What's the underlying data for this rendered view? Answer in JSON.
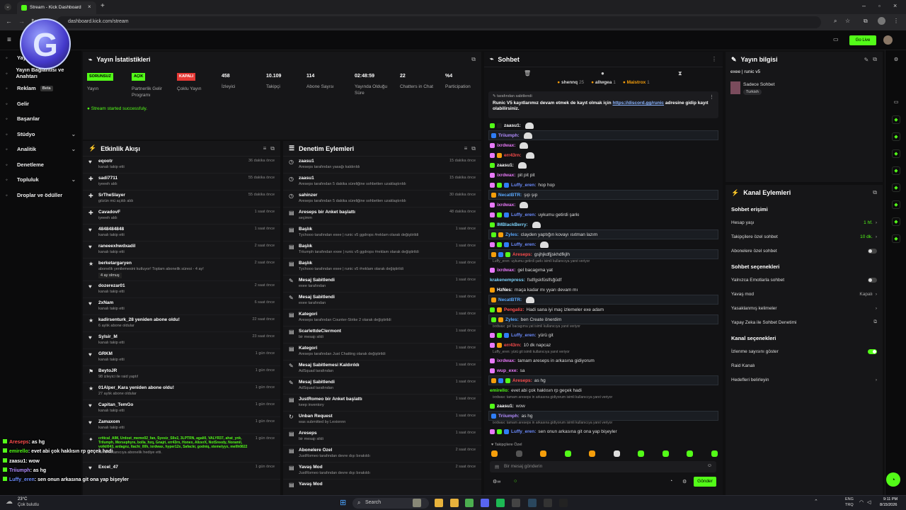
{
  "browser": {
    "tab_title": "Stream - Kick Dashboard",
    "url": "dashboard.kick.com/stream",
    "tab_close": "×",
    "new_tab": "+"
  },
  "topnav": {
    "go_live": "Go Live"
  },
  "sidebar": {
    "items": [
      {
        "label": "Yayın",
        "icon": "stream-icon"
      },
      {
        "label": "Yayın Bağlantısı ve Anahtarı",
        "icon": "link-icon"
      },
      {
        "label": "Reklam",
        "badge": "Beta",
        "icon": "ad-icon"
      },
      {
        "label": "Gelir",
        "icon": "revenue-icon"
      },
      {
        "label": "Başarılar",
        "icon": "achievements-icon"
      },
      {
        "label": "Stüdyo",
        "chevron": "⌄",
        "icon": "studio-icon"
      },
      {
        "label": "Analitik",
        "chevron": "⌄",
        "icon": "analytics-icon"
      },
      {
        "label": "Denetleme",
        "icon": "moderation-icon"
      },
      {
        "label": "Topluluk",
        "chevron": "⌄",
        "icon": "community-icon"
      },
      {
        "label": "Droplar ve ödüller",
        "icon": "drops-icon"
      }
    ]
  },
  "stats": {
    "title": "Yayın İstatistikleri",
    "items": [
      {
        "value": "SORUNSUZ",
        "label": "Yayın",
        "badge_color": "#53fc18"
      },
      {
        "value": "AÇIK",
        "label": "Partnerlik Gelir Programı",
        "badge_color": "#53fc18"
      },
      {
        "value": "KAPALI",
        "label": "Çoklu Yayın",
        "badge_color": "#e53935"
      },
      {
        "value": "458",
        "label": "İzleyici"
      },
      {
        "value": "10.109",
        "label": "Takipçi"
      },
      {
        "value": "114",
        "label": "Abone Sayısı"
      },
      {
        "value": "02:48:59",
        "label": "Yayında Olduğu Süre"
      },
      {
        "value": "22",
        "label": "Chatters in Chat"
      },
      {
        "value": "%4",
        "label": "Participation"
      }
    ],
    "status": "Stream started successfuly."
  },
  "activity": {
    "title": "Etkinlik Akışı",
    "items": [
      {
        "name": "eqootr",
        "sub": "kanalı takip etti",
        "time": "36 dakika önce",
        "icon": "♥"
      },
      {
        "name": "sadi7711",
        "sub": "iyeeeh aldı",
        "time": "55 dakika önce",
        "icon": "✚"
      },
      {
        "name": "SrTheSlayer",
        "sub": "gözün mü açıldı aldı",
        "time": "55 dakika önce",
        "icon": "✚"
      },
      {
        "name": "CavadovF",
        "sub": "iyeeeh aldı",
        "time": "1 saat önce",
        "icon": "✚"
      },
      {
        "name": "4848484848",
        "sub": "kanalı takip etti",
        "time": "1 saat önce",
        "icon": "♥"
      },
      {
        "name": "raneeexhwdxadil",
        "sub": "kanalı takip etti",
        "time": "2 saat önce",
        "icon": "♥"
      },
      {
        "name": "berketargaryen",
        "sub": "abonelik yenilemesini kutluyor! Toplam abonelik süresi - 4 ay!",
        "extra": "4 ay olmuş",
        "time": "2 saat önce",
        "icon": "★"
      },
      {
        "name": "dozerezar01",
        "sub": "kanalı takip etti",
        "time": "2 saat önce",
        "icon": "♥"
      },
      {
        "name": "2xNam",
        "sub": "kanalı takip etti",
        "time": "6 saat önce",
        "icon": "♥"
      },
      {
        "name": "kadirsenturk_28 yeniden abone oldu!",
        "sub": "6 aylık abone oldular",
        "time": "22 saat önce",
        "icon": "★"
      },
      {
        "name": "Sylsir_M",
        "sub": "kanalı takip etti",
        "time": "23 saat önce",
        "icon": "♥"
      },
      {
        "name": "GRKM",
        "sub": "kanalı takip etti",
        "time": "1 gün önce",
        "icon": "♥"
      },
      {
        "name": "BeytoJR",
        "sub": "98 izleyici ile raid yaptı!",
        "time": "1 gün önce",
        "icon": "⚑"
      },
      {
        "name": "01Alper_Kara yeniden abone oldu!",
        "sub": "27 aylık abone oldular",
        "time": "1 gün önce",
        "icon": "★"
      },
      {
        "name": "Capitan_TemGo",
        "sub": "kanalı takip etti",
        "time": "1 gün önce",
        "icon": "♥"
      },
      {
        "name": "Zamaxom",
        "sub": "kanalı takip etti",
        "time": "1 gün önce",
        "icon": "♥"
      },
      {
        "name": "critical_AIM, Urdost_memo02_fan, Syesiz_S6v2, 3LPTRN, agali0, VALYR37, ahat_ynk, Trilumph, Morsephyre, bolla_hzq, Gnajri, err43rn, Honex, AlizerX, NotSreedy, Noramil, volkil043, ardagnz, Itachi_00h, ixrdwax, hyper12x, Safackr, godniq, xtemelyyx, mellh0822",
        "sub": "isimli kullanıcıya abonelik hediye etti.",
        "time": "1 gün önce",
        "icon": "✦"
      },
      {
        "name": "Excel_47",
        "sub": "",
        "time": "1 gün önce",
        "icon": "♥"
      }
    ]
  },
  "moderation": {
    "title": "Denetim Eylemleri",
    "items": [
      {
        "name": "zaasu1",
        "sub": "Areseps tarafından yasağı kaldırıldı",
        "time": "15 dakika önce",
        "icon": "◷"
      },
      {
        "name": "zaasu1",
        "sub": "Areseps tarafından 5 dakika süreliğine sohbetten uzaklaştırıldı",
        "time": "15 dakika önce",
        "icon": "◷"
      },
      {
        "name": "sahinzer",
        "sub": "Areseps tarafından 5 dakika süreliğine sohbetten uzaklaştırıldı",
        "time": "30 dakika önce",
        "icon": "◷"
      },
      {
        "name": "Areseps bir Anket başlattı",
        "sub": "seçimm",
        "time": "48 dakika önce",
        "icon": "▤"
      },
      {
        "name": "Başlık",
        "sub": "Tychooo tarafından exee | runic v5 ggdrops #reklam olarak değiştirildi",
        "time": "1 saat önce",
        "icon": "▤"
      },
      {
        "name": "Başlık",
        "sub": "Triiumph tarafından exee | runic v5 ggdrops #reklam olarak değiştirildi",
        "time": "1 saat önce",
        "icon": "▤"
      },
      {
        "name": "Başlık",
        "sub": "Tychooo tarafından exee | runic v5 #reklam olarak değiştirildi",
        "time": "1 saat önce",
        "icon": "▤"
      },
      {
        "name": "Mesaj Sabitlendi",
        "sub": "exee tarafından",
        "time": "1 saat önce",
        "icon": "✎"
      },
      {
        "name": "Mesaj Sabitlendi",
        "sub": "exee tarafından",
        "time": "1 saat önce",
        "icon": "✎"
      },
      {
        "name": "Kategori",
        "sub": "Areseps tarafından Counter-Strike 2 olarak değiştirildi",
        "time": "1 saat önce",
        "icon": "▤"
      },
      {
        "name": "ScarlettdeClermont",
        "sub": "bir mesajı sildi",
        "time": "1 saat önce",
        "icon": "▤"
      },
      {
        "name": "Kategori",
        "sub": "Areseps tarafından Just Chatting olarak değiştirildi",
        "time": "1 saat önce",
        "icon": "▤"
      },
      {
        "name": "Mesaj Sabitlemesi Kaldırıldı",
        "sub": "AdSquad tarafından",
        "time": "1 saat önce",
        "icon": "✎"
      },
      {
        "name": "Mesaj Sabitlendi",
        "sub": "AdSquad tarafından",
        "time": "1 saat önce",
        "icon": "✎"
      },
      {
        "name": "JustRomeo bir Anket başlattı",
        "sub": "keep inventory",
        "time": "1 saat önce",
        "icon": "▤"
      },
      {
        "name": "Unban Request",
        "sub": "was submitted by Lexionnn",
        "time": "1 saat önce",
        "icon": "↻"
      },
      {
        "name": "Areseps",
        "sub": "bir mesajı sildi",
        "time": "1 saat önce",
        "icon": "▤"
      },
      {
        "name": "Abonelere Özel",
        "sub": "JustRomeo tarafından devre dışı bırakıldı",
        "time": "2 saat önce",
        "icon": "▤"
      },
      {
        "name": "Yavaş Mod",
        "sub": "JustRomeo tarafından devre dışı bırakıldı",
        "time": "2 saat önce",
        "icon": "▤"
      },
      {
        "name": "Yavaş Mod",
        "sub": "",
        "time": "",
        "icon": "▤"
      }
    ]
  },
  "chat": {
    "title": "Sohbet",
    "top_gifters": [
      {
        "name": "shennq",
        "n": "25"
      },
      {
        "name": "allwgea",
        "n": "1"
      },
      {
        "name": "Maistrox",
        "n": "1"
      }
    ],
    "pinned": {
      "by": "tarafından sabitlendi",
      "text": "Runic V5 kayıtlarımız devam etmek de kayıt olmak için",
      "link": "https://discord.gg/runic",
      "text2": "adresine gidip kayıt olabilirsiniz."
    },
    "lines": [
      {
        "u": "zaasu1:",
        "c": "#ffffff",
        "m": "",
        "b": [
          "#53fc18",
          "#1e1e1e"
        ]
      },
      {
        "u": "Triiumph:",
        "c": "#b28cff",
        "m": "",
        "b": [
          "#2f7df6"
        ],
        "hl": true
      },
      {
        "u": "ixrdwax:",
        "c": "#e879f9",
        "m": "",
        "b": [
          "#e879f9"
        ]
      },
      {
        "u": "err43rn:",
        "c": "#ff4d4d",
        "m": "",
        "b": [
          "#e879f9",
          "#f59e0b"
        ]
      },
      {
        "u": "zaasu1:",
        "c": "#ffffff",
        "m": "",
        "b": [
          "#53fc18"
        ]
      },
      {
        "u": "ixrdwax:",
        "c": "#e879f9",
        "m": "pit pit pit",
        "b": [
          "#e879f9"
        ]
      },
      {
        "u": "Luffy_eren:",
        "c": "#6c8cff",
        "m": "hop hop",
        "b": [
          "#e879f9",
          "#53fc18",
          "#2f7df6"
        ]
      },
      {
        "u": "NecatBTR:",
        "c": "#5aa9ff",
        "m": "şıp şıp",
        "b": [
          "#f59e0b"
        ],
        "hl": true
      },
      {
        "u": "ixrdwax:",
        "c": "#e879f9",
        "m": "",
        "b": [
          "#e879f9"
        ]
      },
      {
        "u": "Luffy_eren:",
        "c": "#6c8cff",
        "m": "uykumu getirdi şarkı",
        "b": [
          "#e879f9",
          "#53fc18",
          "#2f7df6"
        ]
      },
      {
        "u": "IMBlackBerry:",
        "c": "#7dd3fc",
        "m": "",
        "b": [
          "#53fc18"
        ]
      },
      {
        "u": "Zyles:",
        "c": "#5aa9ff",
        "m": "clayden yaptığın kovayı ısıtman lazım",
        "b": [
          "#53fc18",
          "#f59e0b"
        ],
        "hl": true
      },
      {
        "u": "Luffy_eren:",
        "c": "#6c8cff",
        "m": "",
        "b": [
          "#e879f9",
          "#53fc18",
          "#2f7df6"
        ]
      },
      {
        "u": "Areseps:",
        "c": "#ff4d4d",
        "m": "gsjhjkdfjjskhdfkjlh",
        "b": [
          "#f59e0b",
          "#2f7df6",
          "#53fc18"
        ],
        "hl": true
      }
    ],
    "lines2": [
      {
        "u": "ixrdwax:",
        "c": "#e879f9",
        "m": "gel bacagıma yat",
        "b": [
          "#e879f9"
        ],
        "sys": "Luffy_eren: uykumu getirdi şarkı isimli kullanıcıya yanıt veriyor"
      },
      {
        "u": "krakenempress:",
        "c": "#7dd3fc",
        "m": "fsdfgskfüslfsğüdf",
        "b": []
      },
      {
        "u": "HzNes:",
        "c": "#ffffff",
        "m": "maça kadar mı yyarı devam mı",
        "b": [
          "#f59e0b"
        ]
      },
      {
        "u": "NecatBTR:",
        "c": "#5aa9ff",
        "m": "",
        "b": [
          "#f59e0b"
        ],
        "hl": true
      },
      {
        "u": "Pengaliz:",
        "c": "#ff4d4d",
        "m": "Hadi sana iyi maç izlemeler exe adam",
        "b": [
          "#53fc18",
          "#f59e0b"
        ]
      },
      {
        "u": "Zyles:",
        "c": "#5aa9ff",
        "m": "ben Create önerdim",
        "b": [
          "#53fc18",
          "#f59e0b"
        ],
        "hl": true
      },
      {
        "u": "Luffy_eren:",
        "c": "#6c8cff",
        "m": "yürü git",
        "b": [
          "#e879f9",
          "#53fc18",
          "#2f7df6"
        ],
        "sys": "ixrdwax: gel bacagıma yat isimli kullanıcıya yanıt veriyor"
      },
      {
        "u": "err43rn:",
        "c": "#ff4d4d",
        "m": "10 dk napcaz",
        "b": [
          "#e879f9",
          "#f59e0b"
        ]
      },
      {
        "u": "ixrdwax:",
        "c": "#e879f9",
        "m": "tamam areseps in arkasına gidiyorum",
        "b": [
          "#e879f9"
        ],
        "sys": "Luffy_eren: yürü git isimli kullanıcıya yanıt veriyor"
      },
      {
        "u": "wup_exe:",
        "c": "#e879f9",
        "m": "sa",
        "b": [
          "#e879f9"
        ]
      },
      {
        "u": "Areseps:",
        "c": "#ff4d4d",
        "m": "as hg",
        "b": [
          "#f59e0b",
          "#2f7df6",
          "#53fc18"
        ],
        "hl": true
      },
      {
        "u": "emirello:",
        "c": "#53fc18",
        "m": "evet abi çok haklısın rp geçek hadi",
        "b": []
      },
      {
        "u": "zaasu1:",
        "c": "#ffffff",
        "m": "wow",
        "b": [
          "#53fc18"
        ],
        "sys": "ixrdwax: tamam areseps in arkasına gidiyorum isimli kullanıcıya yanıt veriyor"
      },
      {
        "u": "Triiumph:",
        "c": "#b28cff",
        "m": "as hg",
        "b": [
          "#2f7df6"
        ],
        "hl": true
      },
      {
        "u": "Luffy_eren:",
        "c": "#6c8cff",
        "m": "sen onun arkasına git ona yap bişeyler",
        "b": [
          "#e879f9",
          "#53fc18",
          "#2f7df6"
        ],
        "sys": "ixrdwax: tamam areseps in arkasına gidiyorum isimli kullanıcıya yanıt veriyor"
      }
    ],
    "subs_label": "Takipçilere Özel",
    "input_placeholder": "Bir mesaj gönderin",
    "send": "Gönder"
  },
  "info": {
    "title": "Yayın bilgisi",
    "stream_title": "exee | runic v5",
    "category": "Sadece Sohbet",
    "tag": "Turkish"
  },
  "channel": {
    "title": "Kanal Eylemleri",
    "chat_access": "Sohbet erişimi",
    "access_rows": [
      {
        "label": "Hesap yaşı",
        "value": "1 hf.",
        "type": "chev"
      },
      {
        "label": "Takipçilere özel sohbet",
        "value": "10 dk.",
        "type": "chev"
      },
      {
        "label": "Abonelere özel sohbet",
        "type": "toggle",
        "on": false
      }
    ],
    "chat_options": "Sohbet seçenekleri",
    "option_rows": [
      {
        "label": "Yalnızca Emotlarla sohbet",
        "type": "toggle",
        "on": false
      },
      {
        "label": "Yavaş mod",
        "value": "Kapalı",
        "type": "chev"
      },
      {
        "label": "Yasaklanmış kelimeler",
        "type": "chev"
      },
      {
        "label": "Yapay Zeka ile Sohbet Denetimi",
        "type": "ext"
      }
    ],
    "channel_options": "Kanal seçenekleri",
    "channel_rows": [
      {
        "label": "İzlenme sayısını göster",
        "type": "toggle",
        "on": true
      },
      {
        "label": "Raid Kanalı",
        "type": "none"
      },
      {
        "label": "Hedefleri belirleyin",
        "type": "chev"
      }
    ]
  },
  "overlay": [
    {
      "u": "Areseps",
      "m": ": as hg",
      "c": "#ff4d4d"
    },
    {
      "u": "emirello",
      "m": ": evet abi çok haklısın rp geçek hadi",
      "c": "#53fc18"
    },
    {
      "u": "zaasu1",
      "m": ": wow",
      "c": "#ffffff"
    },
    {
      "u": "Triiumph",
      "m": ": as hg",
      "c": "#b28cff"
    },
    {
      "u": "Luffy_eren",
      "m": ": sen onun arkasına git ona yap bişeyler",
      "c": "#6c8cff"
    }
  ],
  "taskbar": {
    "weather_temp": "23°C",
    "weather_desc": "Çok bulutlu",
    "search": "Search",
    "lang1": "ENG",
    "lang2": "TRQ",
    "time": "9:11 PM",
    "date": "8/15/2026"
  },
  "colors": {
    "accent": "#53fc18",
    "panel": "#161618",
    "bg": "#0f0f10"
  }
}
